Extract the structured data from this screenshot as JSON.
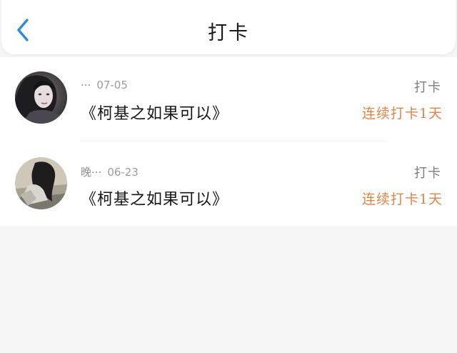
{
  "header": {
    "title": "打卡",
    "back_icon": "chevron-left-icon",
    "accent_color": "#2f8cdd"
  },
  "records": [
    {
      "name": "···",
      "date": "07-05",
      "book": "《柯基之如果可以》",
      "label": "打卡",
      "streak": "连续打卡1天"
    },
    {
      "name": "晚···",
      "date": "06-23",
      "book": "《柯基之如果可以》",
      "label": "打卡",
      "streak": "连续打卡1天"
    }
  ],
  "colors": {
    "streak": "#e0854a",
    "muted": "#9c9c9c",
    "background": "#f7f6f7"
  }
}
